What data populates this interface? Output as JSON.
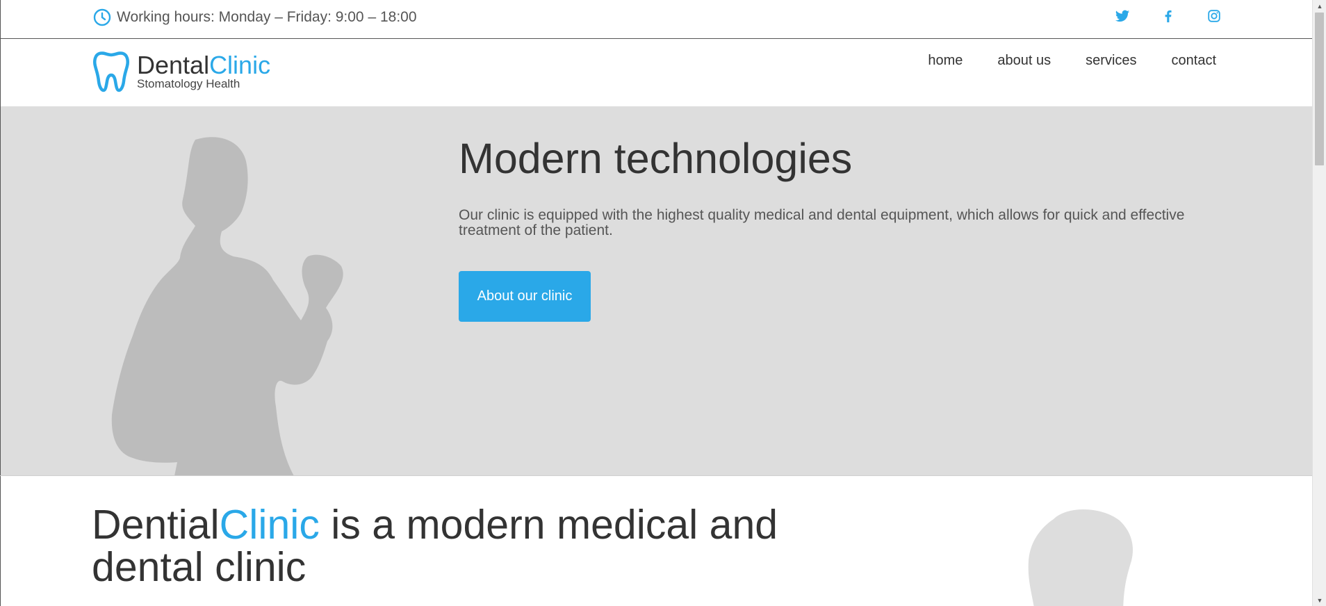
{
  "topbar": {
    "working_hours": "Working hours: Monday – Friday: 9:00 – 18:00",
    "social": [
      {
        "name": "twitter-icon"
      },
      {
        "name": "facebook-icon"
      },
      {
        "name": "instagram-icon"
      }
    ]
  },
  "logo": {
    "name_part1": "Dental",
    "name_part2": "Clinic",
    "tagline": "Stomatology Health"
  },
  "nav": {
    "items": [
      "home",
      "about us",
      "services",
      "contact"
    ]
  },
  "hero": {
    "title": "Modern technologies",
    "description": "Our clinic is equipped with the highest quality medical and dental equipment, which allows for quick and effective treatment of the patient.",
    "button_label": "About our clinic"
  },
  "about": {
    "heading_part1": "Dential",
    "heading_part2": "Clinic",
    "heading_part3": " is a modern medical and dental clinic"
  },
  "colors": {
    "accent": "#2aa8e8",
    "hero_bg": "#dddddd",
    "silhouette": "#bcbcbc",
    "text": "#333333"
  }
}
